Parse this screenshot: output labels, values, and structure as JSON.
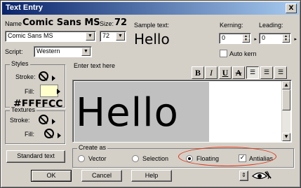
{
  "window": {
    "title": "Text Entry",
    "close_label": "X"
  },
  "font": {
    "name_label": "Name",
    "name_display": "Comic Sans MS",
    "name_value": "Comic Sans MS",
    "size_label": "Size:",
    "size_display": "72",
    "size_value": "72",
    "script_label": "Script:",
    "script_value": "Western"
  },
  "sample": {
    "label": "Sample text:",
    "text": "Hello"
  },
  "kerning": {
    "label": "Kerning:",
    "value": "0"
  },
  "leading": {
    "label": "Leading:",
    "value": "0"
  },
  "auto_kern": {
    "label": "Auto kern",
    "checked": false
  },
  "styles": {
    "title": "Styles",
    "stroke_label": "Stroke:",
    "fill_label": "Fill:",
    "fill_color": "#FFFFCC",
    "fill_color_label": "#FFFFCC"
  },
  "textures": {
    "title": "Textures",
    "stroke_label": "Stroke:",
    "fill_label": "Fill:"
  },
  "editor": {
    "label": "Enter text here",
    "text": "Hello",
    "buttons": [
      "B",
      "I",
      "U",
      "A"
    ]
  },
  "standard_text_button": "Standard text",
  "create_as": {
    "title": "Create as",
    "options": [
      "Vector",
      "Selection",
      "Floating"
    ],
    "selected": "Floating",
    "antialias_label": "Antialias",
    "antialias_checked": true
  },
  "buttons": {
    "ok": "OK",
    "cancel": "Cancel",
    "help": "Help"
  },
  "colors": {
    "highlight_ellipse": "#e03010",
    "selection": "#c0c0c0"
  }
}
